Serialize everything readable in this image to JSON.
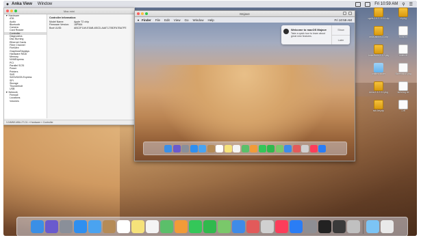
{
  "host_menubar": {
    "apple": "",
    "app_name": "Anka View",
    "items": [
      "Window"
    ],
    "clock": "Fri 10:59 AM"
  },
  "sysinfo": {
    "title": "Mac mini",
    "sidebar": [
      {
        "label": "▼ Hardware",
        "level": "grp"
      },
      {
        "label": "ATA",
        "level": "sub"
      },
      {
        "label": "Audio",
        "level": "sub"
      },
      {
        "label": "Bluetooth",
        "level": "sub"
      },
      {
        "label": "Camera",
        "level": "sub"
      },
      {
        "label": "Card Reader",
        "level": "sub"
      },
      {
        "label": "Controller",
        "level": "sub",
        "selected": true
      },
      {
        "label": "Diagnostics",
        "level": "sub"
      },
      {
        "label": "Disc Burning",
        "level": "sub"
      },
      {
        "label": "Ethernet Cards",
        "level": "sub"
      },
      {
        "label": "Fibre Channel",
        "level": "sub"
      },
      {
        "label": "FireWire",
        "level": "sub"
      },
      {
        "label": "Graphics/Displays",
        "level": "sub"
      },
      {
        "label": "Hardware RAID",
        "level": "sub"
      },
      {
        "label": "Memory",
        "level": "sub"
      },
      {
        "label": "NVMExpress",
        "level": "sub"
      },
      {
        "label": "PCI",
        "level": "sub"
      },
      {
        "label": "Parallel SCSI",
        "level": "sub"
      },
      {
        "label": "Power",
        "level": "sub"
      },
      {
        "label": "Printers",
        "level": "sub"
      },
      {
        "label": "SAS",
        "level": "sub"
      },
      {
        "label": "SATA/SATA Express",
        "level": "sub"
      },
      {
        "label": "SPI",
        "level": "sub"
      },
      {
        "label": "Storage",
        "level": "sub"
      },
      {
        "label": "Thunderbolt",
        "level": "sub"
      },
      {
        "label": "USB",
        "level": "sub"
      },
      {
        "label": "▼ Network",
        "level": "grp"
      },
      {
        "label": "Firewall",
        "level": "sub"
      },
      {
        "label": "Locations",
        "level": "sub"
      },
      {
        "label": "Volumes",
        "level": "sub"
      }
    ],
    "detail_heading": "Controller Information:",
    "detail_rows": [
      {
        "k": "Model Name:",
        "v": "Apple T2 chip"
      },
      {
        "k": "Firmware Version:",
        "v": "16P564"
      },
      {
        "k": "Boot UUID:",
        "v": "ABC2F1A9-E5AB-4BCD-AA6T-278DFA7BA7FE"
      }
    ],
    "pathbar": "VJ4MN9-M8U-2T-D1 » Hardware » Controller"
  },
  "vm": {
    "title": "Mojave",
    "menubar": {
      "app_name": "Finder",
      "items": [
        "File",
        "Edit",
        "View",
        "Go",
        "Window",
        "Help"
      ],
      "clock": "Fri 10:59 AM"
    },
    "notification": {
      "title": "Welcome to macOS Mojave",
      "body": "Take a quick tour to learn about great new features.",
      "show_label": "Show",
      "later_label": "Later"
    },
    "dock_icons": [
      "finder-icon",
      "siri-icon",
      "launchpad-icon",
      "safari-icon",
      "mail-icon",
      "contacts-icon",
      "calendar-icon",
      "notes-icon",
      "reminders-icon",
      "maps-icon",
      "photos-icon",
      "messages-icon",
      "facetime-icon",
      "itunes-icon",
      "books-icon",
      "app-store-icon",
      "system-preferences-icon",
      "downloads-icon",
      "trash-icon"
    ]
  },
  "desktop_icons": [
    {
      "label": "ogefs-1.6.2-10.14.zip",
      "kind": "zip"
    },
    {
      "label": "xh.pkg",
      "kind": "zip"
    },
    {
      "label": "anka-addon-14.zip",
      "kind": "zip"
    },
    {
      "label": "tools.txt",
      "kind": "doc"
    },
    {
      "label": "Anka-Build-1.4.2.pkg",
      "kind": "zip"
    },
    {
      "label": "notes.rtf",
      "kind": "doc"
    },
    {
      "label": "untitled folder",
      "kind": "fld"
    },
    {
      "label": "Screenshot.png",
      "kind": "doc"
    },
    {
      "label": "Anka-1.4.2.0.1.pkg",
      "kind": "zip"
    },
    {
      "label": "build-log.txt",
      "kind": "doc"
    },
    {
      "label": "ssh-key.zip",
      "kind": "zip"
    },
    {
      "label": "1.rtf",
      "kind": "doc"
    }
  ],
  "host_dock_icons": [
    "finder-icon",
    "siri-icon",
    "launchpad-icon",
    "safari-icon",
    "mail-icon",
    "contacts-icon",
    "calendar-icon",
    "notes-icon",
    "reminders-icon",
    "maps-icon",
    "photos-icon",
    "messages-icon",
    "facetime-icon",
    "numbers-icon",
    "keynote-icon",
    "news-icon",
    "stocks-icon",
    "itunes-icon",
    "app-store-icon",
    "system-preferences-icon",
    "terminal-icon",
    "console-icon",
    "anka-icon",
    "downloads-icon",
    "trash-icon"
  ],
  "colors": {
    "sidebar_selection": "#dcdcdc",
    "notification_icon": "#2d2d2d"
  }
}
